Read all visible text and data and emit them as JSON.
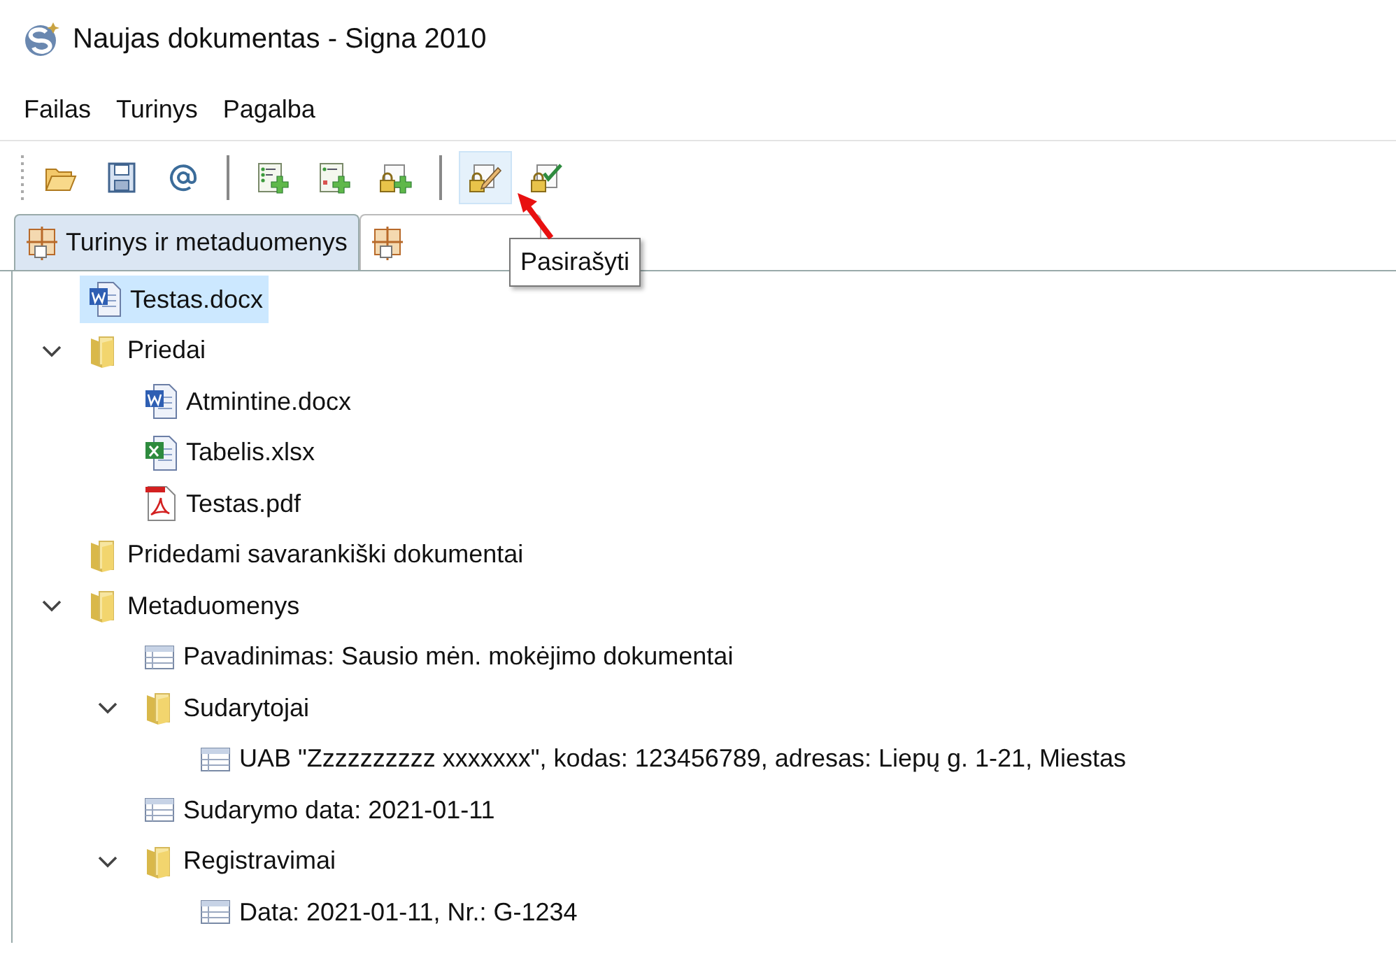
{
  "window": {
    "title": "Naujas dokumentas - Signa 2010"
  },
  "menu": [
    "Failas",
    "Turinys",
    "Pagalba"
  ],
  "toolbar": [
    {
      "kind": "open",
      "highlighted": false
    },
    {
      "kind": "save",
      "highlighted": false
    },
    {
      "kind": "email",
      "highlighted": false
    },
    {
      "kind": "separator"
    },
    {
      "kind": "add-list",
      "highlighted": false
    },
    {
      "kind": "add-list-red",
      "highlighted": false
    },
    {
      "kind": "add-lock",
      "highlighted": false
    },
    {
      "kind": "separator"
    },
    {
      "kind": "sign",
      "highlighted": true
    },
    {
      "kind": "verify",
      "highlighted": false
    }
  ],
  "tooltip": {
    "text": "Pasirašyti"
  },
  "tabs": [
    {
      "label": "Turinys ir metaduomenys",
      "selected": true
    },
    {
      "selected": false
    }
  ],
  "tree": [
    {
      "kind": "word",
      "label": "Testas.docx",
      "selected": true
    },
    {
      "kind": "folder",
      "label": "Priedai",
      "expanded": true,
      "selected": false,
      "children": [
        {
          "kind": "word",
          "label": "Atmintine.docx",
          "selected": false
        },
        {
          "kind": "excel",
          "label": "Tabelis.xlsx",
          "selected": false
        },
        {
          "kind": "pdf",
          "label": "Testas.pdf",
          "selected": false
        }
      ]
    },
    {
      "kind": "folder",
      "label": "Pridedami savarankiški dokumentai",
      "selected": false
    },
    {
      "kind": "folder",
      "label": "Metaduomenys",
      "expanded": true,
      "selected": false,
      "children": [
        {
          "kind": "field",
          "label": "Pavadinimas: Sausio mėn. mokėjimo dokumentai",
          "selected": false
        },
        {
          "kind": "folder",
          "label": "Sudarytojai",
          "expanded": true,
          "selected": false,
          "children": [
            {
              "kind": "field",
              "label": "UAB \"Zzzzzzzzzz xxxxxxx\", kodas: 123456789, adresas: Liepų g. 1-21, Miestas",
              "selected": false
            }
          ]
        },
        {
          "kind": "field",
          "label": "Sudarymo data: 2021-01-11",
          "selected": false
        },
        {
          "kind": "folder",
          "label": "Registravimai",
          "expanded": true,
          "selected": false,
          "children": [
            {
              "kind": "field",
              "label": "Data: 2021-01-11, Nr.: G-1234",
              "selected": false
            }
          ]
        }
      ]
    }
  ]
}
